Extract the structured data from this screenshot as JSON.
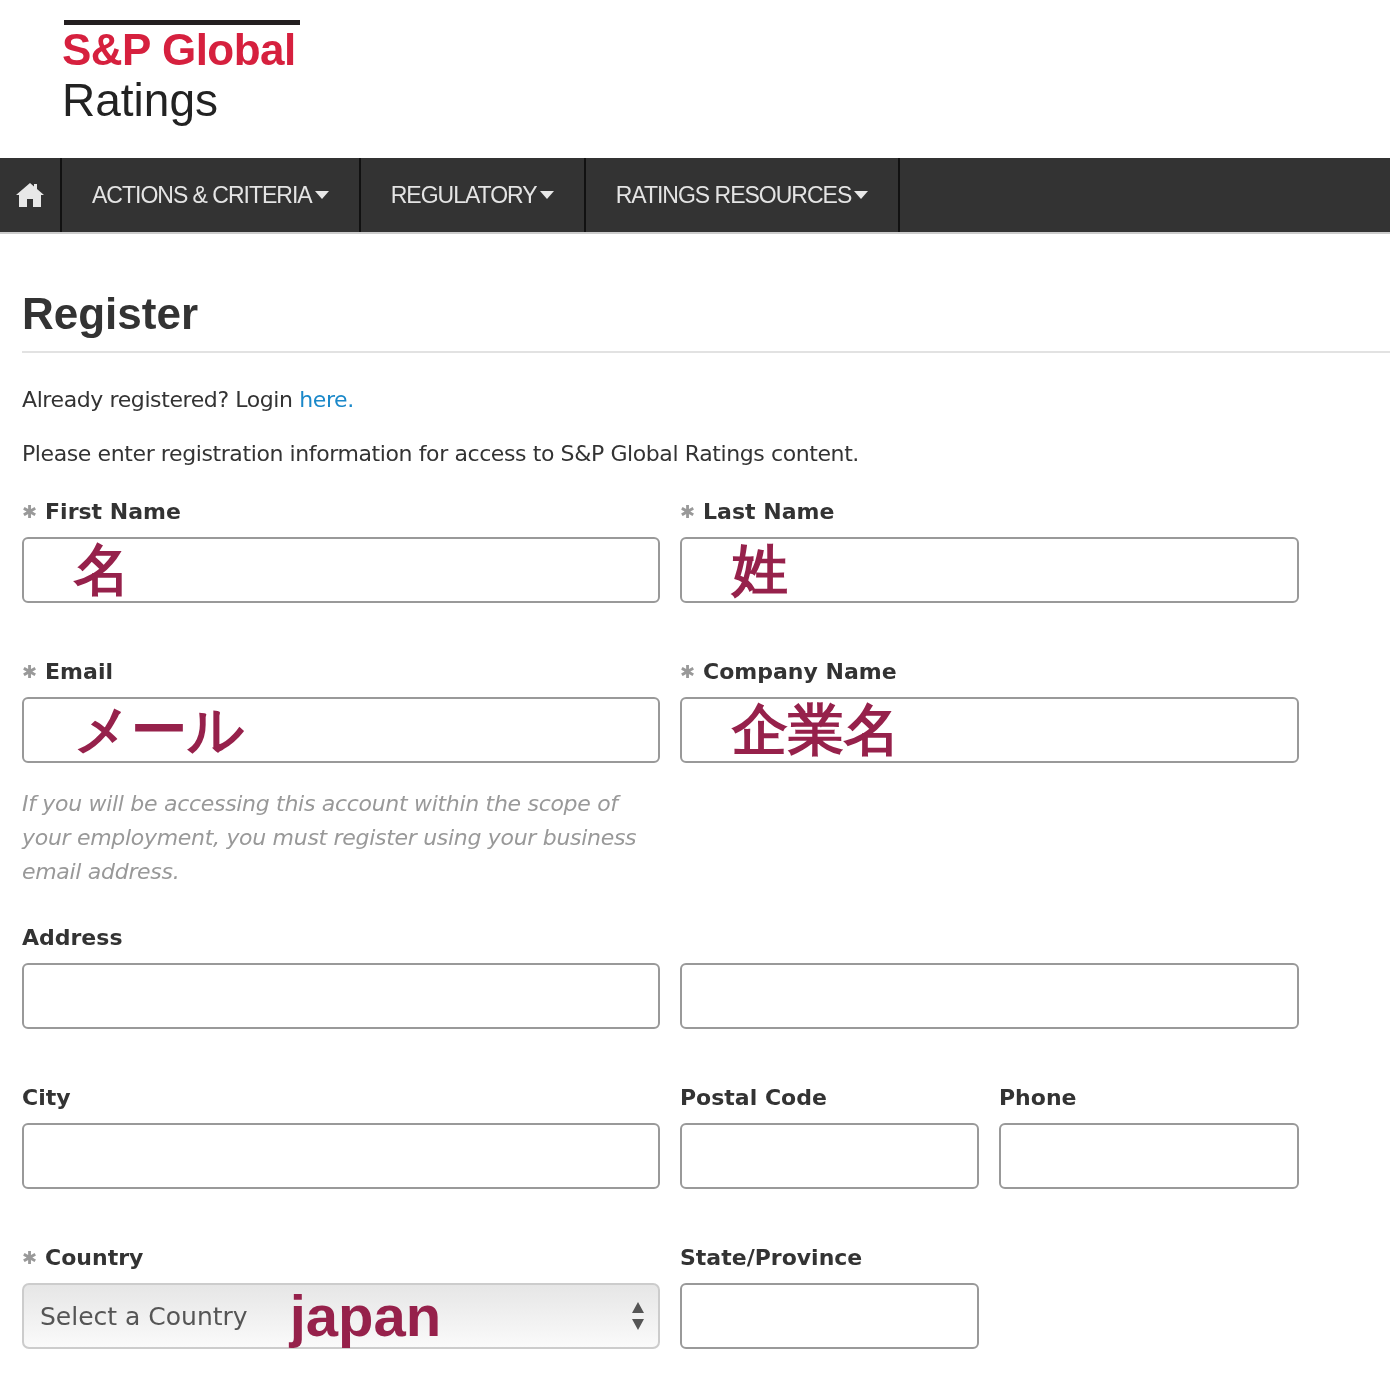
{
  "logo": {
    "brand": "S&P Global",
    "product": "Ratings"
  },
  "nav": [
    {
      "label": "ACTIONS & CRITERIA",
      "dropdown": true
    },
    {
      "label": "REGULATORY",
      "dropdown": true
    },
    {
      "label": "RATINGS RESOURCES",
      "dropdown": true
    }
  ],
  "page_title": "Register",
  "login_prompt": {
    "text": "Already registered? Login",
    "link": "here."
  },
  "intro": "Please enter registration information for access to S&P Global Ratings content.",
  "form_rows": [
    [
      {
        "kind": "text",
        "marker": "✱",
        "label": "First Name",
        "annotation": "名"
      },
      {
        "kind": "text",
        "marker": "✱",
        "label": "Last Name",
        "annotation": "姓"
      }
    ],
    [
      {
        "kind": "text",
        "marker": "✱",
        "label": "Email",
        "annotation": "メール"
      },
      {
        "kind": "text",
        "marker": "✱",
        "label": "Company Name",
        "annotation": "企業名"
      }
    ],
    [
      {
        "kind": "hint",
        "label": "If you will be accessing this account within the scope of your employment, you must register using your business email address."
      }
    ],
    [
      {
        "kind": "text",
        "label": "Address"
      },
      {
        "kind": "text"
      }
    ],
    [
      {
        "kind": "text",
        "label": "City"
      },
      {
        "kind": "text",
        "label": "Postal Code"
      },
      {
        "kind": "text",
        "label": "Phone"
      }
    ],
    [
      {
        "kind": "select",
        "marker": "✱",
        "label": "Country",
        "placeholder": "Select a Country",
        "annotation": "japan"
      },
      {
        "kind": "text",
        "label": "State/Province"
      }
    ]
  ]
}
